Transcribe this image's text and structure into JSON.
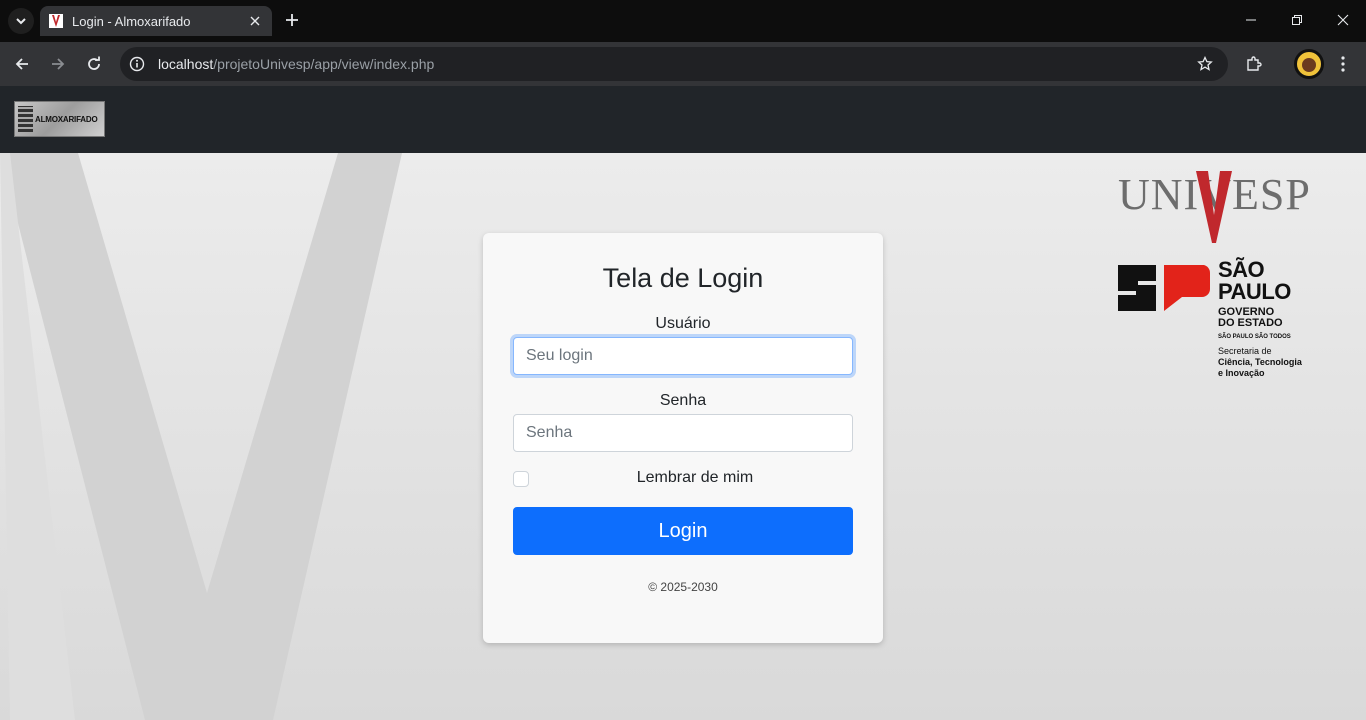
{
  "browser": {
    "tab_title": "Login - Almoxarifado",
    "url_host": "localhost",
    "url_path": "/projetoUnivesp/app/view/index.php",
    "icons": [
      "tab-search-icon",
      "close-icon",
      "new-tab-icon",
      "minimize-icon",
      "restore-icon",
      "window-close-icon",
      "back-icon",
      "forward-icon",
      "reload-icon",
      "site-info-icon",
      "star-icon",
      "extensions-icon",
      "menu-icon"
    ]
  },
  "navbar": {
    "brand": "ALMOXARIFADO"
  },
  "logos": {
    "univesp": "UNIVESP",
    "sp_line1": "SÃO",
    "sp_line2": "PAULO",
    "gov_line1": "GOVERNO",
    "gov_line2": "DO ESTADO",
    "slogan": "SÃO PAULO SÃO TODOS",
    "sec_line1": "Secretaria de",
    "sec_line2": "Ciência, Tecnologia",
    "sec_line3": "e Inovação"
  },
  "form": {
    "title": "Tela de Login",
    "user_label": "Usuário",
    "user_placeholder": "Seu login",
    "user_value": "",
    "pass_label": "Senha",
    "pass_placeholder": "Senha",
    "pass_value": "",
    "remember_label": "Lembrar de mim",
    "remember_checked": false,
    "login_button": "Login",
    "copyright": "© 2025-2030"
  },
  "colors": {
    "primary": "#0d6efd",
    "navbar": "#212529",
    "sp_red": "#e2231a"
  }
}
